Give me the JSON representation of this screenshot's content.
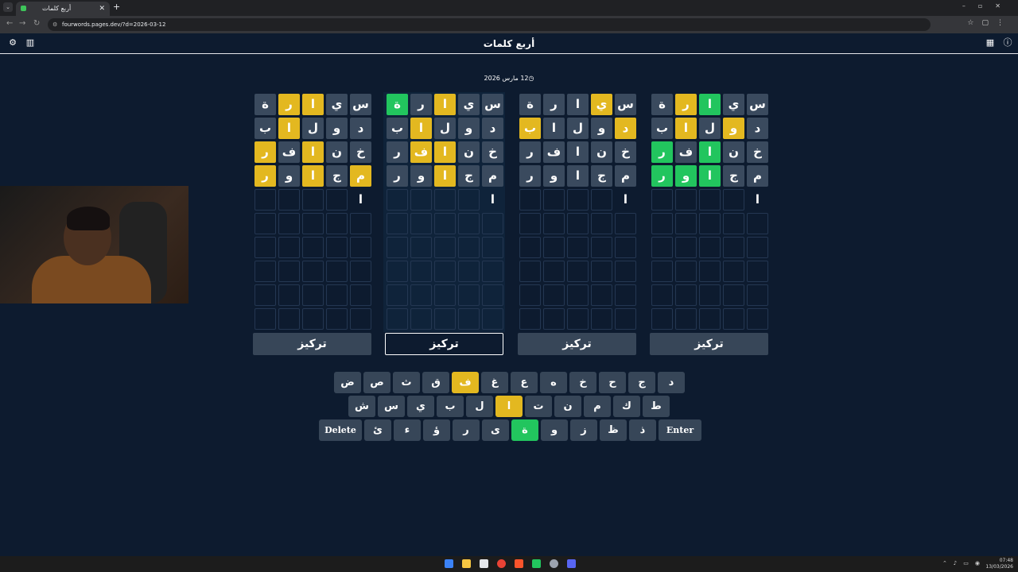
{
  "browser": {
    "tab_title": "أربع كلمات",
    "url": "fourwords.pages.dev/?d=2026-03-12"
  },
  "app": {
    "title": "أربع كلمات",
    "date": "12 مارس 2026"
  },
  "focus_label": "تركيز",
  "boards": [
    {
      "rows": [
        [
          [
            "س",
            "c"
          ],
          [
            "ي",
            "c"
          ],
          [
            "ا",
            "y"
          ],
          [
            "ر",
            "y"
          ],
          [
            "ة",
            "c"
          ]
        ],
        [
          [
            "د",
            "c"
          ],
          [
            "و",
            "c"
          ],
          [
            "ل",
            "c"
          ],
          [
            "ا",
            "y"
          ],
          [
            "ب",
            "c"
          ]
        ],
        [
          [
            "خ",
            "c"
          ],
          [
            "ن",
            "c"
          ],
          [
            "ا",
            "y"
          ],
          [
            "ف",
            "c"
          ],
          [
            "ر",
            "y"
          ]
        ],
        [
          [
            "م",
            "y"
          ],
          [
            "ج",
            "c"
          ],
          [
            "ا",
            "y"
          ],
          [
            "و",
            "c"
          ],
          [
            "ر",
            "y"
          ]
        ],
        [
          [
            "ا",
            "t"
          ],
          [
            "",
            ""
          ],
          [
            "",
            ""
          ],
          [
            "",
            ""
          ],
          [
            "",
            ""
          ]
        ]
      ]
    },
    {
      "rows": [
        [
          [
            "س",
            "c"
          ],
          [
            "ي",
            "c"
          ],
          [
            "ا",
            "y"
          ],
          [
            "ر",
            "c"
          ],
          [
            "ة",
            "g"
          ]
        ],
        [
          [
            "د",
            "c"
          ],
          [
            "و",
            "c"
          ],
          [
            "ل",
            "c"
          ],
          [
            "ا",
            "y"
          ],
          [
            "ب",
            "c"
          ]
        ],
        [
          [
            "خ",
            "c"
          ],
          [
            "ن",
            "c"
          ],
          [
            "ا",
            "y"
          ],
          [
            "ف",
            "y"
          ],
          [
            "ر",
            "c"
          ]
        ],
        [
          [
            "م",
            "c"
          ],
          [
            "ج",
            "c"
          ],
          [
            "ا",
            "y"
          ],
          [
            "و",
            "c"
          ],
          [
            "ر",
            "c"
          ]
        ],
        [
          [
            "ا",
            "t"
          ],
          [
            "",
            ""
          ],
          [
            "",
            ""
          ],
          [
            "",
            ""
          ],
          [
            "",
            ""
          ]
        ]
      ]
    },
    {
      "rows": [
        [
          [
            "س",
            "c"
          ],
          [
            "ي",
            "y"
          ],
          [
            "ا",
            "c"
          ],
          [
            "ر",
            "c"
          ],
          [
            "ة",
            "c"
          ]
        ],
        [
          [
            "د",
            "y"
          ],
          [
            "و",
            "c"
          ],
          [
            "ل",
            "c"
          ],
          [
            "ا",
            "c"
          ],
          [
            "ب",
            "y"
          ]
        ],
        [
          [
            "خ",
            "c"
          ],
          [
            "ن",
            "c"
          ],
          [
            "ا",
            "c"
          ],
          [
            "ف",
            "c"
          ],
          [
            "ر",
            "c"
          ]
        ],
        [
          [
            "م",
            "c"
          ],
          [
            "ج",
            "c"
          ],
          [
            "ا",
            "c"
          ],
          [
            "و",
            "c"
          ],
          [
            "ر",
            "c"
          ]
        ],
        [
          [
            "ا",
            "t"
          ],
          [
            "",
            ""
          ],
          [
            "",
            ""
          ],
          [
            "",
            ""
          ],
          [
            "",
            ""
          ]
        ]
      ]
    },
    {
      "rows": [
        [
          [
            "س",
            "c"
          ],
          [
            "ي",
            "c"
          ],
          [
            "ا",
            "g"
          ],
          [
            "ر",
            "y"
          ],
          [
            "ة",
            "c"
          ]
        ],
        [
          [
            "د",
            "c"
          ],
          [
            "و",
            "y"
          ],
          [
            "ل",
            "c"
          ],
          [
            "ا",
            "y"
          ],
          [
            "ب",
            "c"
          ]
        ],
        [
          [
            "خ",
            "c"
          ],
          [
            "ن",
            "c"
          ],
          [
            "ا",
            "g"
          ],
          [
            "ف",
            "c"
          ],
          [
            "ر",
            "g"
          ]
        ],
        [
          [
            "م",
            "c"
          ],
          [
            "ج",
            "c"
          ],
          [
            "ا",
            "g"
          ],
          [
            "و",
            "g"
          ],
          [
            "ر",
            "g"
          ]
        ],
        [
          [
            "ا",
            "t"
          ],
          [
            "",
            ""
          ],
          [
            "",
            ""
          ],
          [
            "",
            ""
          ],
          [
            "",
            ""
          ]
        ]
      ]
    }
  ],
  "keyboard": {
    "row1": [
      [
        "د",
        ""
      ],
      [
        "ج",
        ""
      ],
      [
        "ح",
        ""
      ],
      [
        "خ",
        ""
      ],
      [
        "ه",
        ""
      ],
      [
        "ع",
        ""
      ],
      [
        "غ",
        ""
      ],
      [
        "ف",
        "y"
      ],
      [
        "ق",
        ""
      ],
      [
        "ث",
        ""
      ],
      [
        "ص",
        ""
      ],
      [
        "ض",
        ""
      ]
    ],
    "row2": [
      [
        "ط",
        ""
      ],
      [
        "ك",
        ""
      ],
      [
        "م",
        ""
      ],
      [
        "ن",
        ""
      ],
      [
        "ت",
        ""
      ],
      [
        "ا",
        "y"
      ],
      [
        "ل",
        ""
      ],
      [
        "ب",
        ""
      ],
      [
        "ي",
        ""
      ],
      [
        "س",
        ""
      ],
      [
        "ش",
        ""
      ]
    ],
    "row3": [
      [
        "Enter",
        "w"
      ],
      [
        "ذ",
        ""
      ],
      [
        "ظ",
        ""
      ],
      [
        "ز",
        ""
      ],
      [
        "و",
        ""
      ],
      [
        "ة",
        "g"
      ],
      [
        "ى",
        ""
      ],
      [
        "ر",
        ""
      ],
      [
        "ؤ",
        ""
      ],
      [
        "ء",
        ""
      ],
      [
        "ئ",
        ""
      ],
      [
        "Delete",
        "w"
      ]
    ]
  },
  "colors": {
    "correct": "#22c55e",
    "present": "#e3b820",
    "absent": "#3a4a5e",
    "background": "#0d1b2f"
  },
  "icons": {
    "settings": "gear-icon",
    "stats": "bar-chart-icon",
    "calendar": "calendar-icon",
    "info": "info-icon",
    "clock": "clock-icon"
  },
  "taskbar": {
    "time": "07:48",
    "date": "13/03/2026"
  }
}
